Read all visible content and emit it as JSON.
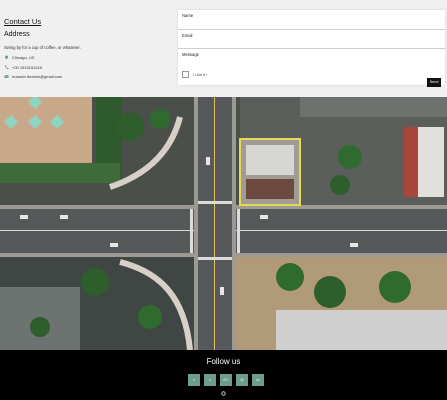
{
  "contact": {
    "title": "Contact Us",
    "address_heading": "Address",
    "tagline": "Swing by for a cup of coffee, or whatever.",
    "location": "Chicago, US",
    "phone": "+00 1515151515",
    "email": "hussein.ibrahim@gmail.com"
  },
  "form": {
    "name_label": "Name",
    "email_label": "Email",
    "message_label": "Message",
    "captcha_label": "I Like It !",
    "send_label": "Send"
  },
  "footer": {
    "follow_label": "Follow us",
    "socials": [
      {
        "label": "f",
        "icon": "facebook-icon"
      },
      {
        "label": "t",
        "icon": "twitter-icon"
      },
      {
        "label": "G+",
        "icon": "google-plus-icon"
      },
      {
        "label": "◎",
        "icon": "instagram-icon"
      },
      {
        "label": "in",
        "icon": "linkedin-icon"
      }
    ]
  },
  "colors": {
    "accent": "#6b9e8a",
    "footer_bg": "#000000",
    "panel_bg": "#f0f0f0"
  }
}
